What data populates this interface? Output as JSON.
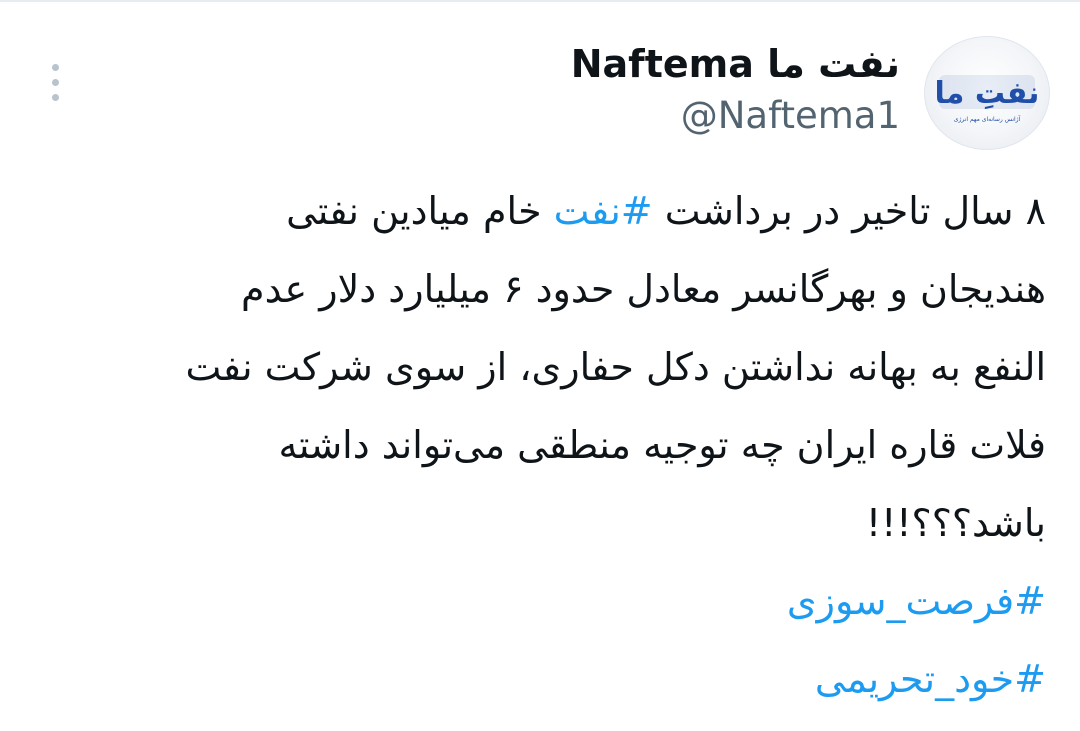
{
  "author": {
    "display_name": "نفت ما Naftema",
    "handle": "@Naftema1",
    "avatar_logo_text": "نفتِ ما",
    "avatar_subtitle": "آژانس رسانه‌ای مهم انرژی"
  },
  "tweet": {
    "line1_before": "۸ سال تاخیر در برداشت ",
    "line1_hashtag": "#نفت",
    "line1_after": " خام میادین نفتی",
    "line2": "هندیجان و بهرگانسر معادل حدود ۶ میلیارد دلار عدم",
    "line3": "النفع به بهانه نداشتن دکل حفاری، از سوی شرکت نفت",
    "line4": "فلات قاره ایران چه توجیه منطقی می‌تواند داشته",
    "line5": "باشد؟؟؟!!!",
    "hashtags": [
      "#فرصت_سوزی",
      "#خود_تحریمی"
    ]
  },
  "colors": {
    "link": "#1d9bf0",
    "text": "#0f1419",
    "muted": "#536471",
    "logo_blue": "#1f4fa8"
  },
  "icons": {
    "more": "vertical-ellipsis-icon"
  }
}
